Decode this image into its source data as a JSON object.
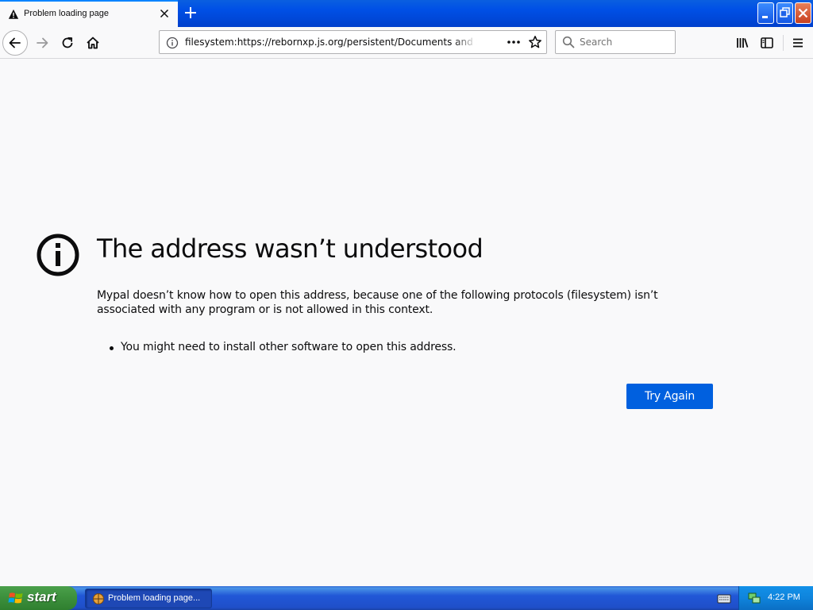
{
  "tab": {
    "title": "Problem loading page",
    "icon": "warning-icon"
  },
  "toolbar": {
    "url": "filesystem:https://rebornxp.js.org/persistent/Documents and Settings",
    "search_placeholder": "Search"
  },
  "error": {
    "title": "The address wasn’t understood",
    "description": "Mypal doesn’t know how to open this address, because one of the following protocols (filesystem) isn’t associated with any program or is not allowed in this context.",
    "hints": [
      "You might need to install other software to open this address."
    ],
    "button_label": "Try Again"
  },
  "taskbar": {
    "start_label": "start",
    "task_label": "Problem loading page...",
    "clock": "4:22 PM"
  },
  "colors": {
    "accent": "#0060df",
    "page_bg": "#f9f9fa",
    "xp_blue": "#2157d7",
    "start_green": "#3c8f3c"
  }
}
